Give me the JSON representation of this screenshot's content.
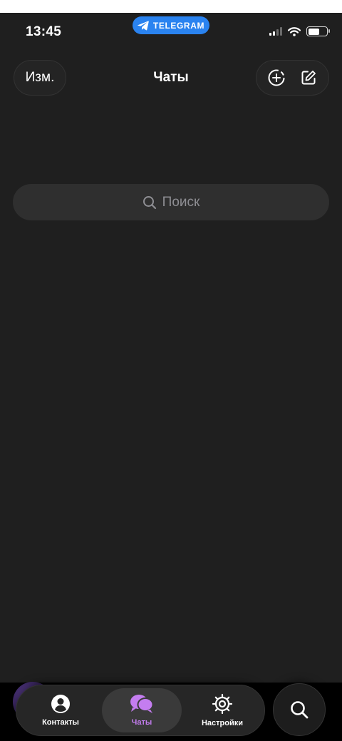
{
  "status_bar": {
    "time": "13:45",
    "app_badge": "TELEGRAM",
    "battery_level": 0.62
  },
  "header": {
    "edit_label": "Изм.",
    "title": "Чаты"
  },
  "search": {
    "placeholder": "Поиск"
  },
  "tabbar": {
    "tabs": [
      {
        "label": "Контакты",
        "icon": "person-icon",
        "active": false
      },
      {
        "label": "Чаты",
        "icon": "chats-icon",
        "active": true
      },
      {
        "label": "Настройки",
        "icon": "gear-icon",
        "active": false
      }
    ]
  },
  "colors": {
    "background": "#1f1f1f",
    "accent": "#c47df0",
    "telegram_blue": "#2a83f0"
  }
}
